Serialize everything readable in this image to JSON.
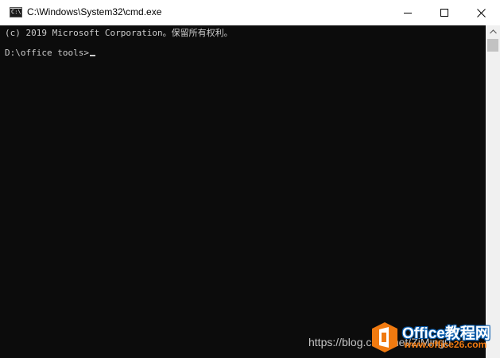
{
  "window": {
    "title": "C:\\Windows\\System32\\cmd.exe",
    "app_icon_text": "C:\\"
  },
  "console": {
    "lines": [
      "(c) 2019 Microsoft Corporation。保留所有权利。",
      "D:\\office tools>"
    ]
  },
  "watermark": {
    "url": "https://blog.csdn.net/ZiMing0",
    "logo_text": "Office教程网",
    "logo_subtext": "www.office26.com"
  },
  "colors": {
    "console_background": "#0c0c0c",
    "console_text": "#cccccc",
    "titlebar": "#ffffff",
    "logo_orange": "#f07a10",
    "logo_blue": "#0b5fb0"
  }
}
